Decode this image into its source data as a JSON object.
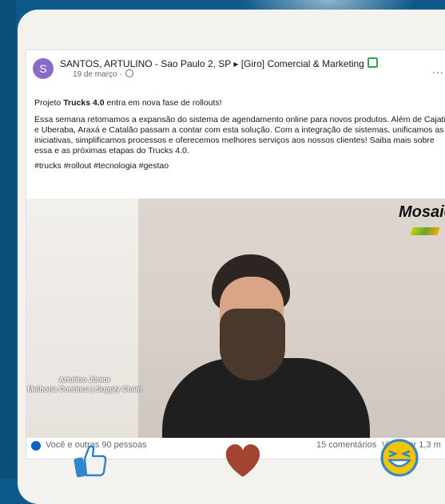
{
  "post": {
    "avatar_letter": "S",
    "author": "SANTOS, ARTULINO - Sao Paulo 2, SP ▸ [Giro] Comercial & Marketing",
    "date": "19 de março · ",
    "more_label": "...",
    "headline_prefix": "Projeto ",
    "headline_bold": "Trucks 4.0",
    "headline_suffix": " entra em nova fase de rollouts!",
    "paragraph": "Essa semana retomamos a expansão do sistema de agendamento online para novos produtos. Além de Cajati e Uberaba, Araxá e Catalão passam a contar com esta solução. Com a integração de sistemas, unificamos as iniciativas, simplificamos processos e oferecemos melhores serviços aos nossos clientes! Saiba mais sobre essa e as próximas etapas do Trucks 4.0.",
    "hashtags": "#trucks #rollout #tecnologia #gestao"
  },
  "video": {
    "logo_text": "Mosaic",
    "lower_third_name": "Artulino Júnior",
    "lower_third_role": "Melhoria Contínua | Supply Chain"
  },
  "stats": {
    "reactions": "Você e outras 90 pessoas",
    "comments": "15 comentários",
    "views": "Visto por 1,3 m"
  },
  "icons": {
    "like": "thumbs-up-icon",
    "heart": "heart-icon",
    "laugh": "laughing-face-icon"
  },
  "colors": {
    "background": "#0d5a8a",
    "heart": "#a2452f",
    "laugh": "#f5c400",
    "like": "#2f86c8"
  }
}
